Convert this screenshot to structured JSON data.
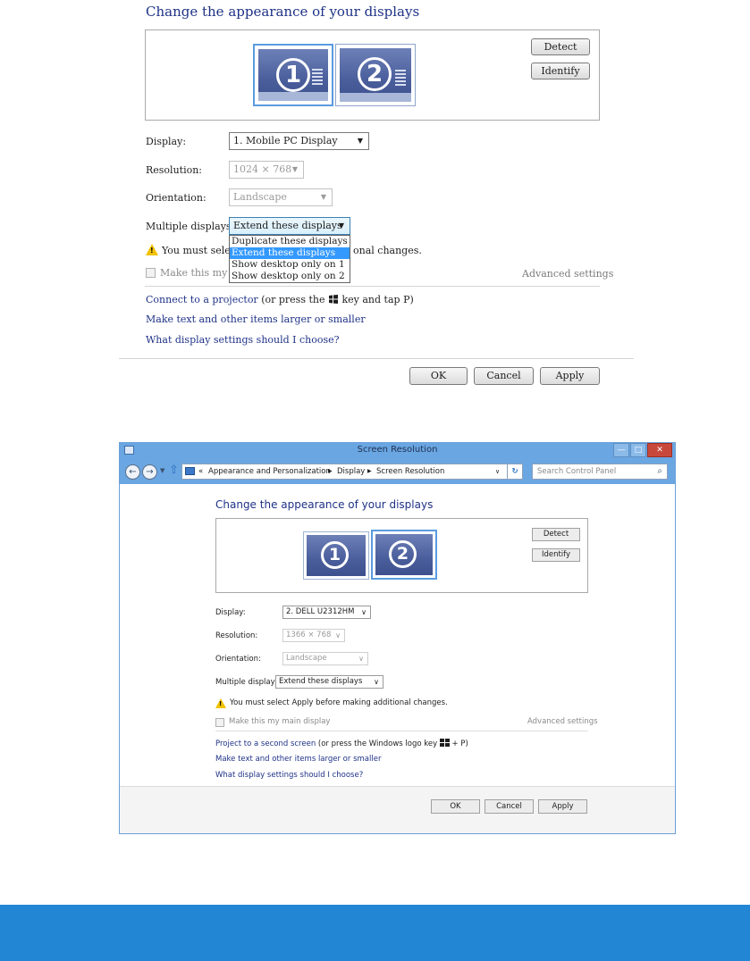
{
  "screen1": {
    "title": "Change the appearance of your displays",
    "monitors": [
      "1",
      "2"
    ],
    "detect_label": "Detect",
    "identify_label": "Identify",
    "display_label": "Display:",
    "display_value": "1. Mobile PC Display",
    "resolution_label": "Resolution:",
    "resolution_value": "1024 × 768",
    "orientation_label": "Orientation:",
    "orientation_value": "Landscape",
    "multiple_label": "Multiple displays:",
    "multiple_value": "Extend these displays",
    "dropdown_options": [
      "Duplicate these displays",
      "Extend these displays",
      "Show desktop only on 1",
      "Show desktop only on 2"
    ],
    "warning_prefix": "You must selec",
    "warning_suffix": "onal changes.",
    "main_display_partial": "Make this my m",
    "advanced_settings": "Advanced settings",
    "connect_link": "Connect to a projector",
    "connect_rest_a": " (or press the ",
    "connect_rest_b": " key and tap P)",
    "text_size_link": "Make text and other items larger or smaller",
    "help_link": "What display settings should I choose?",
    "ok_label": "OK",
    "cancel_label": "Cancel",
    "apply_label": "Apply"
  },
  "screen2": {
    "window_title": "Screen Resolution",
    "breadcrumb": [
      "Appearance and Personalization",
      "Display",
      "Screen Resolution"
    ],
    "breadcrumb_prefix": "«",
    "search_placeholder": "Search Control Panel",
    "title": "Change the appearance of your displays",
    "monitors": [
      "1",
      "2"
    ],
    "detect_label": "Detect",
    "identify_label": "Identify",
    "display_label": "Display:",
    "display_value": "2. DELL U2312HM",
    "resolution_label": "Resolution:",
    "resolution_value": "1366 × 768",
    "orientation_label": "Orientation:",
    "orientation_value": "Landscape",
    "multiple_label": "Multiple displays:",
    "multiple_value": "Extend these displays",
    "warning": "You must select Apply before making additional changes.",
    "main_display": "Make this my main display",
    "advanced_settings": "Advanced settings",
    "project_link": "Project to a second screen",
    "project_rest_a": " (or press the Windows logo key ",
    "project_rest_b": " + P)",
    "text_size_link": "Make text and other items larger or smaller",
    "help_link": "What display settings should I choose?",
    "ok_label": "OK",
    "cancel_label": "Cancel",
    "apply_label": "Apply"
  },
  "colors": {
    "link": "#1e3287",
    "accent_bar": "#2386d4",
    "titlebar": "#6aa6e2",
    "highlight": "#3399ff"
  }
}
